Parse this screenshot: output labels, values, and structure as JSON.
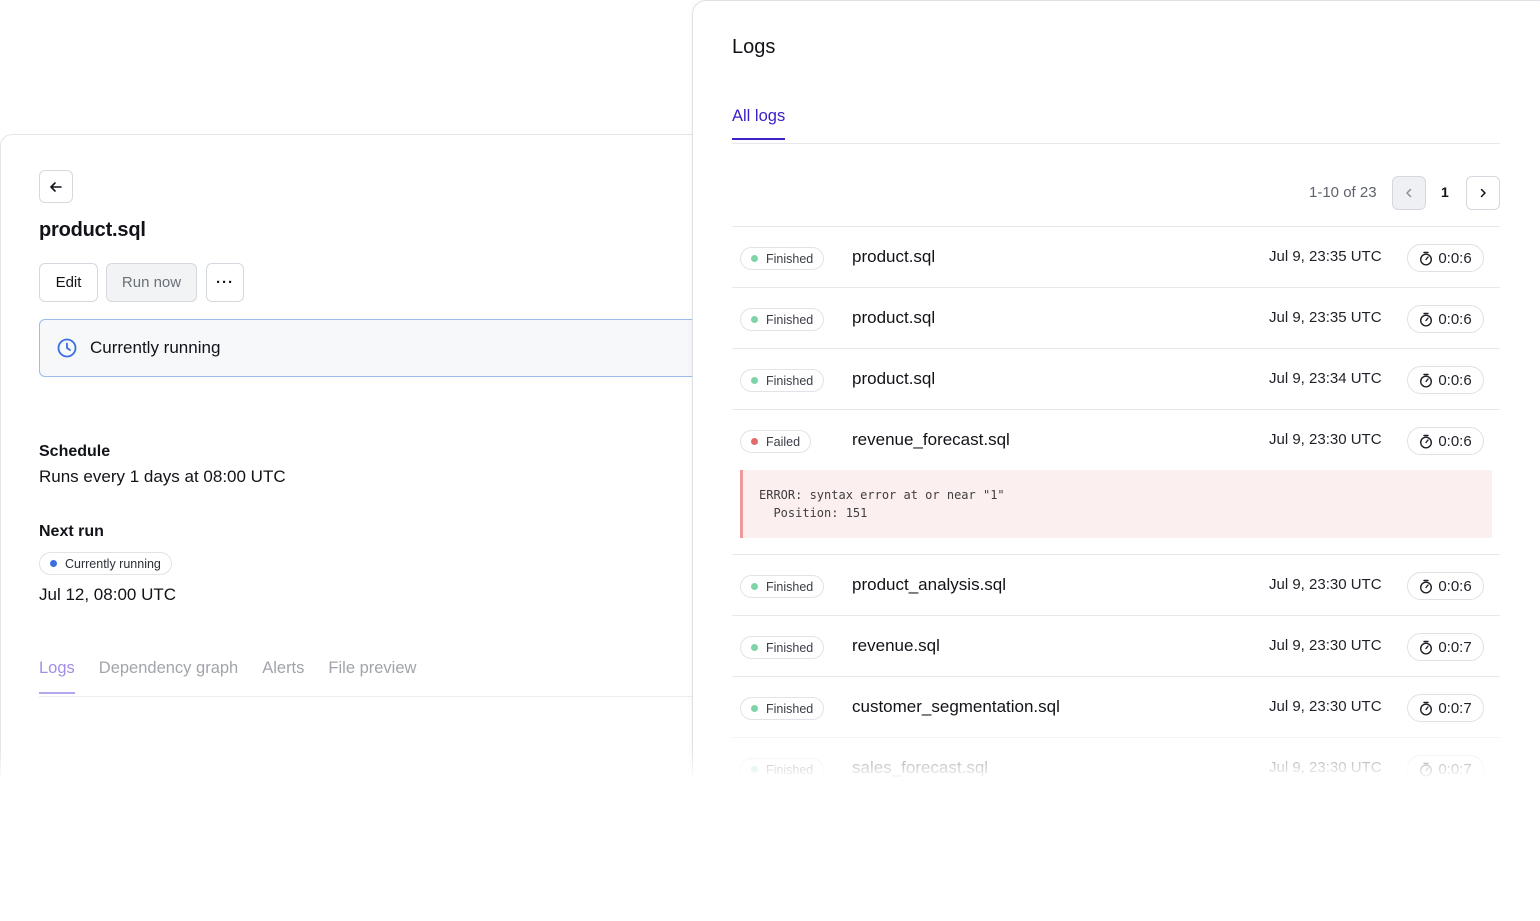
{
  "detail": {
    "title": "product.sql",
    "edit_label": "Edit",
    "run_now_label": "Run now",
    "more_label": "···",
    "banner_text": "Currently running",
    "schedule_label": "Schedule",
    "schedule_value": "Runs every 1 days at 08:00 UTC",
    "next_run_label": "Next run",
    "next_run_badge": "Currently running",
    "next_run_value": "Jul 12, 08:00 UTC",
    "tabs": [
      {
        "label": "Logs",
        "active": true
      },
      {
        "label": "Dependency graph",
        "active": false
      },
      {
        "label": "Alerts",
        "active": false
      },
      {
        "label": "File preview",
        "active": false
      }
    ]
  },
  "logs": {
    "title": "Logs",
    "tab_label": "All logs",
    "pager_count": "1-10 of 23",
    "current_page": "1",
    "rows": [
      {
        "status": "Finished",
        "status_color": "#7fd3a8",
        "name": "product.sql",
        "time": "Jul 9, 23:35 UTC",
        "duration": "0:0:6"
      },
      {
        "status": "Finished",
        "status_color": "#7fd3a8",
        "name": "product.sql",
        "time": "Jul 9, 23:35 UTC",
        "duration": "0:0:6"
      },
      {
        "status": "Finished",
        "status_color": "#7fd3a8",
        "name": "product.sql",
        "time": "Jul 9, 23:34 UTC",
        "duration": "0:0:6"
      },
      {
        "status": "Failed",
        "status_color": "#e16b6b",
        "name": "revenue_forecast.sql",
        "time": "Jul 9, 23:30 UTC",
        "duration": "0:0:6"
      },
      {
        "status": "Finished",
        "status_color": "#7fd3a8",
        "name": "product_analysis.sql",
        "time": "Jul 9, 23:30 UTC",
        "duration": "0:0:6"
      },
      {
        "status": "Finished",
        "status_color": "#7fd3a8",
        "name": "revenue.sql",
        "time": "Jul 9, 23:30 UTC",
        "duration": "0:0:7"
      },
      {
        "status": "Finished",
        "status_color": "#7fd3a8",
        "name": "customer_segmentation.sql",
        "time": "Jul 9, 23:30 UTC",
        "duration": "0:0:7"
      },
      {
        "status": "Finished",
        "status_color": "#7fd3a8",
        "name": "sales_forecast.sql",
        "time": "Jul 9, 23:30 UTC",
        "duration": "0:0:7"
      }
    ],
    "error_text": "ERROR: syntax error at or near \"1\"\n  Position: 151"
  },
  "colors": {
    "accent": "#3a22c8",
    "running_dot": "#3b6fe0",
    "finished": "#7fd3a8",
    "failed": "#e16b6b",
    "banner_border": "#9fbbee",
    "error_bg": "#fcefef"
  },
  "icons": {
    "back": "arrow-left-icon",
    "banner": "clock-icon",
    "duration": "stopwatch-icon",
    "pager_prev": "chevron-left-icon",
    "pager_next": "chevron-right-icon"
  }
}
